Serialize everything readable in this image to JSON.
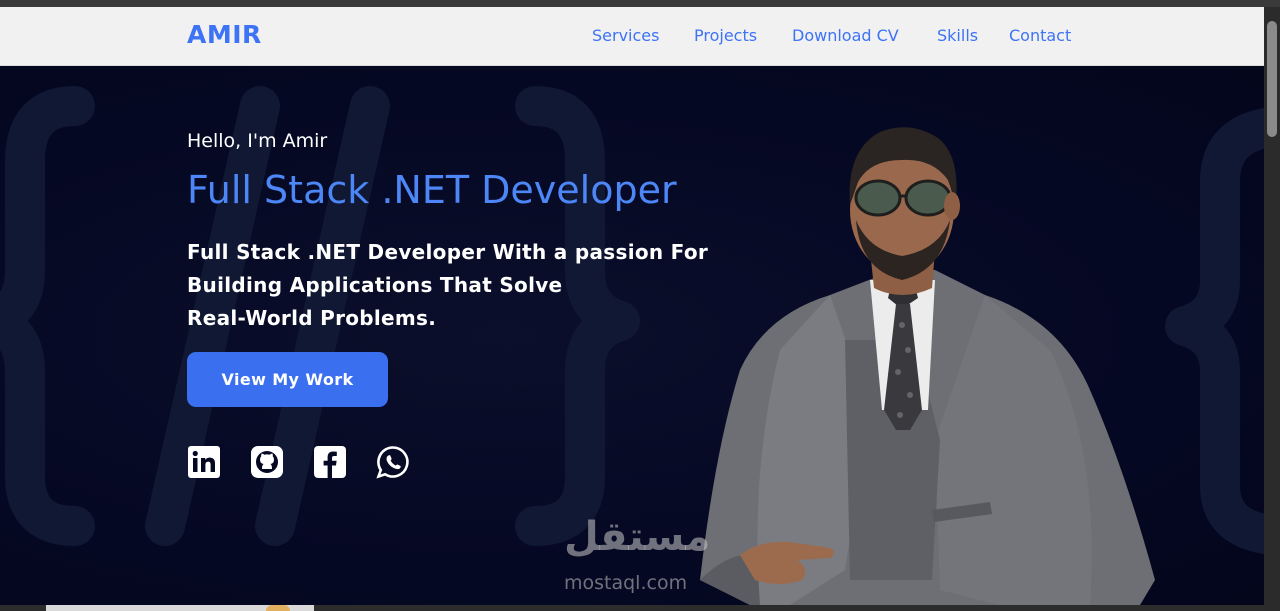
{
  "nav": {
    "logo": "AMIR",
    "links": [
      {
        "label": "Services"
      },
      {
        "label": "Projects"
      },
      {
        "label": "Download CV"
      },
      {
        "label": "Skills"
      },
      {
        "label": "Contact"
      }
    ]
  },
  "hero": {
    "greeting": "Hello, I'm Amir",
    "title": "Full Stack .NET Developer",
    "tagline_lines": [
      "Full Stack .NET Developer With a passion For",
      "Building Applications That Solve",
      "Real-World Problems."
    ],
    "cta_label": "View My Work",
    "social_icons": [
      "linkedin-icon",
      "github-icon",
      "facebook-icon",
      "whatsapp-icon"
    ]
  },
  "watermark": {
    "arabic": "مستقل",
    "latin": "mostaql.com"
  },
  "colors": {
    "accent": "#3d73f5",
    "hero_bg": "#050823",
    "nav_bg": "#f1f1f2",
    "button_bg": "#3a6ff0"
  }
}
